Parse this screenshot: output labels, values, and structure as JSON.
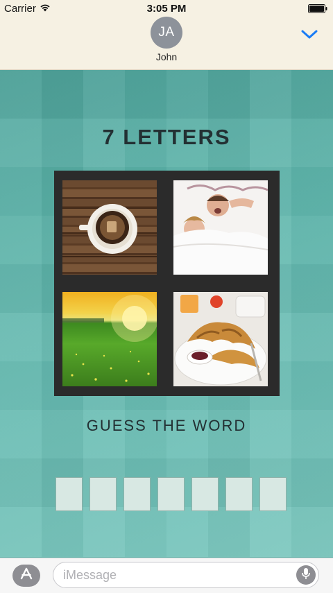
{
  "status_bar": {
    "carrier": "Carrier",
    "time": "3:05 PM"
  },
  "header": {
    "avatar_initials": "JA",
    "contact_name": "John"
  },
  "game": {
    "title": "7 LETTERS",
    "photos": [
      "coffee-on-wood",
      "couple-waking-in-bed",
      "sunrise-over-field",
      "croissant-breakfast"
    ],
    "prompt": "GUESS THE WORD",
    "letter_count": 7
  },
  "compose": {
    "placeholder": "iMessage"
  },
  "colors": {
    "header_bg": "#f6f1e3",
    "game_bg": "#5fb3aa",
    "accent_blue": "#1a7cf5",
    "title_text": "#233033"
  }
}
